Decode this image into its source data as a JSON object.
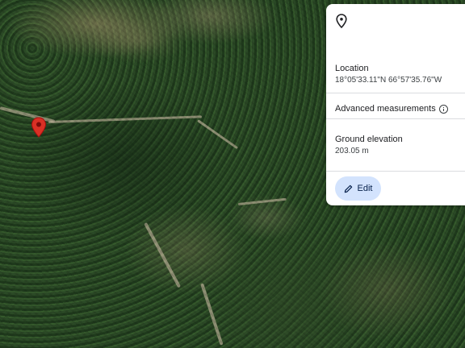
{
  "map": {
    "type": "satellite",
    "marker_icon": "map-pin-icon",
    "marker_color": "#d93025"
  },
  "panel": {
    "header_icon": "place-pin-icon",
    "location_label": "Location",
    "location_value": "18°05'33.11\"N 66°57'35.76\"W",
    "advanced_label": "Advanced measurements",
    "advanced_icon": "info-icon",
    "elevation_label": "Ground elevation",
    "elevation_value": "203.05 m",
    "edit_label": "Edit",
    "edit_icon": "pencil-icon",
    "edit_button_color": "#d3e3fd"
  }
}
